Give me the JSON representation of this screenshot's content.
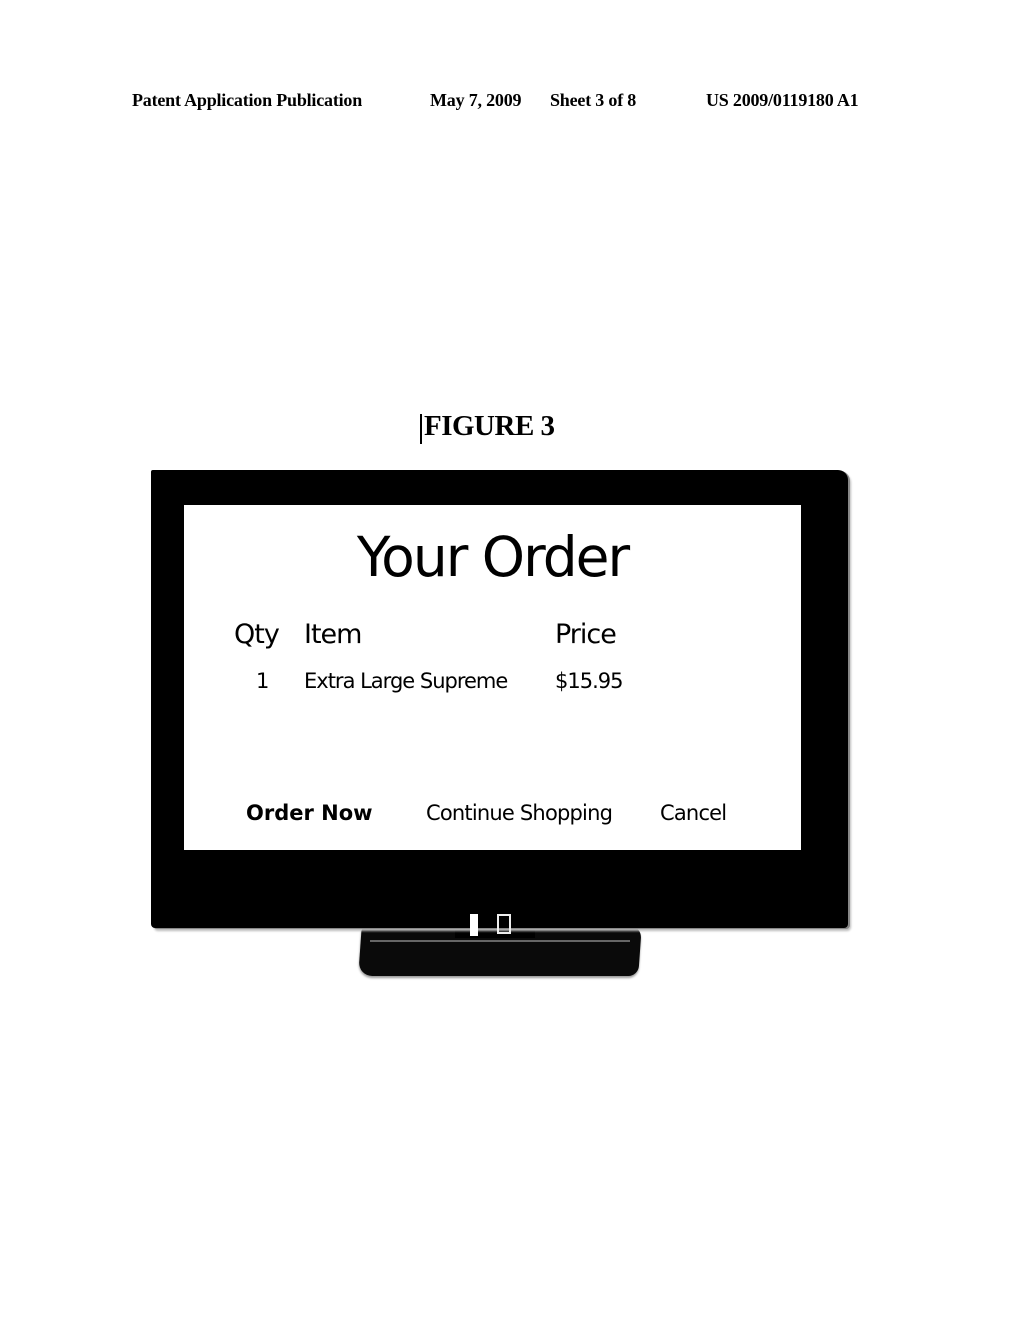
{
  "patent_header": {
    "publication_type": "Patent Application Publication",
    "date": "May 7, 2009",
    "sheet": "Sheet 3 of 8",
    "number": "US 2009/0119180 A1"
  },
  "figure": {
    "label": "FIGURE 3"
  },
  "screen": {
    "title": "Your Order",
    "table": {
      "headers": {
        "qty": "Qty",
        "item": "Item",
        "price": "Price"
      },
      "rows": [
        {
          "qty": "1",
          "item": "Extra Large Supreme",
          "price": "$15.95"
        }
      ]
    },
    "actions": {
      "order_now": "Order Now",
      "continue_shopping": "Continue Shopping",
      "cancel": "Cancel"
    }
  },
  "icons": {
    "device": "television-monitor-icon"
  }
}
